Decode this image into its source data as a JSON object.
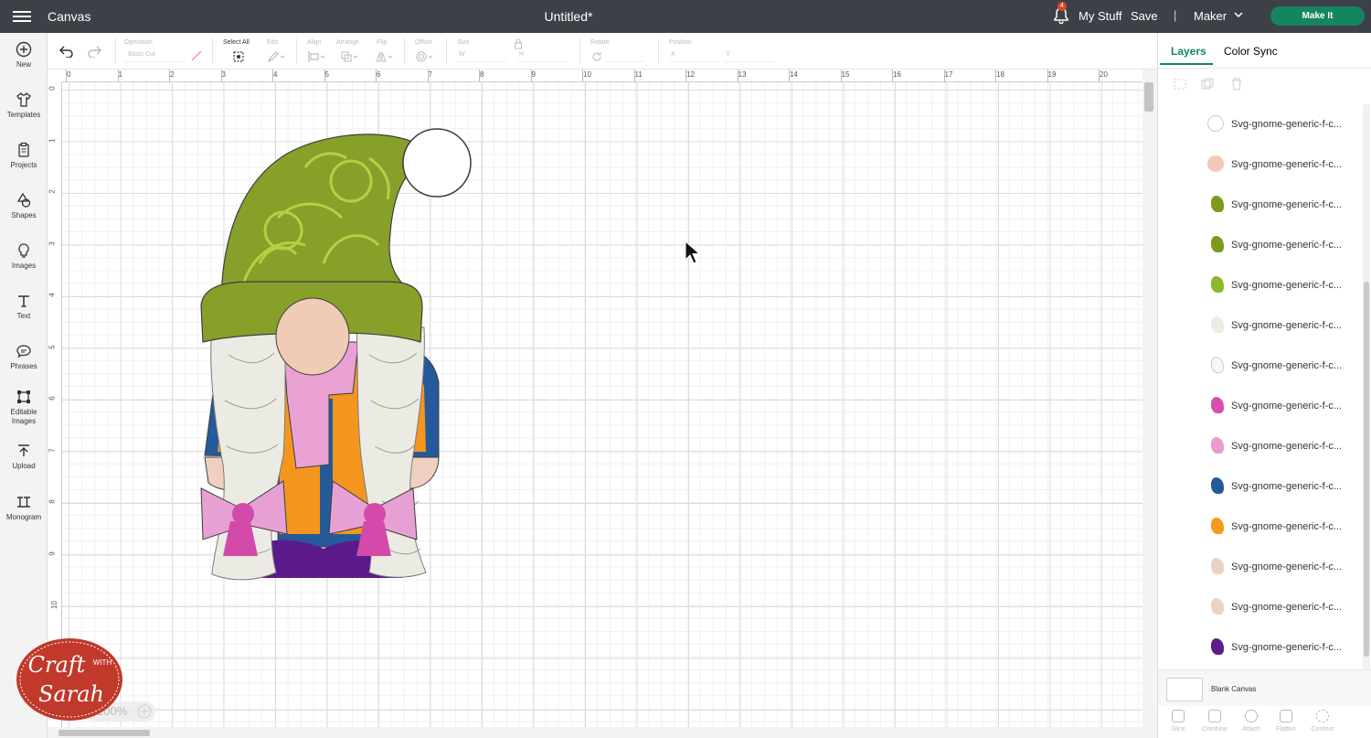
{
  "header": {
    "app_title": "Canvas",
    "doc_title": "Untitled*",
    "notification_count": "4",
    "my_stuff": "My Stuff",
    "save": "Save",
    "separator": "|",
    "machine": "Maker",
    "make_it": "Make It"
  },
  "leftbar": {
    "items": [
      {
        "label": "New",
        "icon": "plus-circle-icon"
      },
      {
        "label": "Templates",
        "icon": "shirt-icon"
      },
      {
        "label": "Projects",
        "icon": "clipboard-icon"
      },
      {
        "label": "Shapes",
        "icon": "shapes-icon"
      },
      {
        "label": "Images",
        "icon": "bulb-icon"
      },
      {
        "label": "Text",
        "icon": "text-icon"
      },
      {
        "label": "Phrases",
        "icon": "speech-bubble-icon"
      },
      {
        "label": "Editable Images",
        "icon": "editable-image-icon"
      },
      {
        "label": "Upload",
        "icon": "upload-icon"
      },
      {
        "label": "Monogram",
        "icon": "monogram-icon"
      }
    ]
  },
  "toolbar": {
    "operation": "Operation",
    "operation_value": "Basic Cut",
    "select_all": "Select All",
    "edit": "Edit",
    "align": "Align",
    "arrange": "Arrange",
    "flip": "Flip",
    "offset": "Offset",
    "size": "Size",
    "size_w": "W",
    "size_h": "H",
    "rotate": "Rotate",
    "position": "Position",
    "pos_x": "X",
    "pos_y": "Y"
  },
  "rulers": {
    "top": [
      "0",
      "1",
      "2",
      "3",
      "4",
      "5",
      "6",
      "7",
      "8",
      "9",
      "10",
      "11",
      "12",
      "13",
      "14",
      "15",
      "16",
      "17",
      "18",
      "19",
      "20"
    ],
    "left": [
      "0",
      "1",
      "2",
      "3",
      "4",
      "5",
      "6",
      "7",
      "8",
      "9",
      "10"
    ]
  },
  "zoom": "100%",
  "panel": {
    "tabs": [
      "Layers",
      "Color Sync"
    ],
    "layers": [
      {
        "name": "Svg-gnome-generic-f-c...",
        "color": "#ffffff"
      },
      {
        "name": "Svg-gnome-generic-f-c...",
        "color": "#f2c9b5"
      },
      {
        "name": "Svg-gnome-generic-f-c...",
        "color": "#7d9a1e"
      },
      {
        "name": "Svg-gnome-generic-f-c...",
        "color": "#7d9a1e"
      },
      {
        "name": "Svg-gnome-generic-f-c...",
        "color": "#8bb82a"
      },
      {
        "name": "Svg-gnome-generic-f-c...",
        "color": "#ecebe4"
      },
      {
        "name": "Svg-gnome-generic-f-c...",
        "color": "#f7f7f7"
      },
      {
        "name": "Svg-gnome-generic-f-c...",
        "color": "#d84fb0"
      },
      {
        "name": "Svg-gnome-generic-f-c...",
        "color": "#e79ccf"
      },
      {
        "name": "Svg-gnome-generic-f-c...",
        "color": "#245a9a"
      },
      {
        "name": "Svg-gnome-generic-f-c...",
        "color": "#f49a1c"
      },
      {
        "name": "Svg-gnome-generic-f-c...",
        "color": "#ecd2c2"
      },
      {
        "name": "Svg-gnome-generic-f-c...",
        "color": "#ecd2c2"
      },
      {
        "name": "Svg-gnome-generic-f-c...",
        "color": "#5d1b8c"
      }
    ],
    "blank_canvas": "Blank Canvas",
    "bottom_tools": [
      "Slice",
      "Combine",
      "Attach",
      "Flatten",
      "Contour"
    ]
  },
  "logo": {
    "line1": "Craft",
    "line2": "WITH",
    "line3": "Sarah"
  },
  "colors": {
    "brand_green": "#14855f",
    "topbar": "#3d4147"
  }
}
